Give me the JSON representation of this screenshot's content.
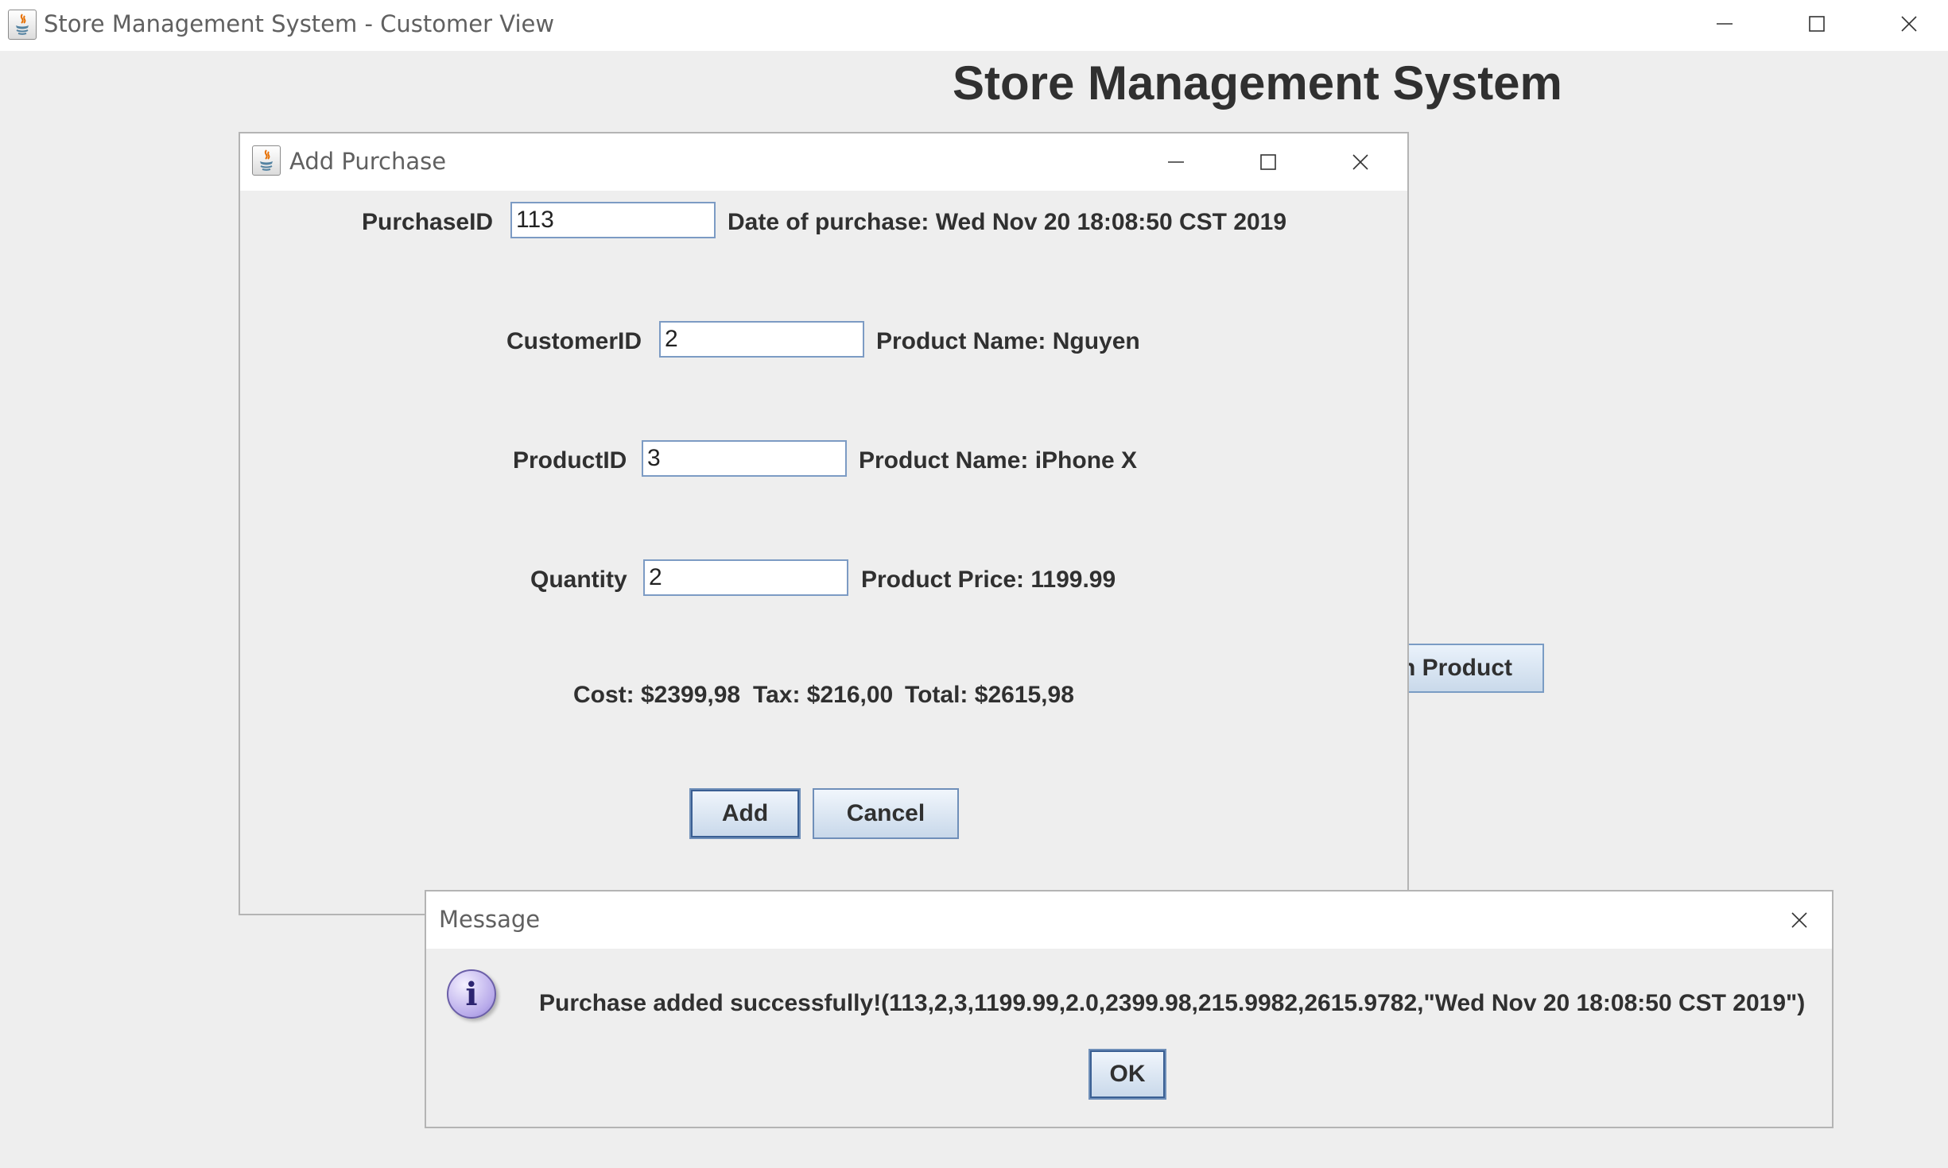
{
  "main_window": {
    "title": "Store Management System - Customer View",
    "heading": "Store Management System",
    "partial_button_label": "n Product"
  },
  "add_purchase": {
    "title": "Add Purchase",
    "purchase_id_label": "PurchaseID",
    "purchase_id_value": "113",
    "date_text": "Date of purchase: Wed Nov 20 18:08:50 CST 2019",
    "customer_id_label": "CustomerID",
    "customer_id_value": "2",
    "customer_name_text": "Product Name: Nguyen",
    "product_id_label": "ProductID",
    "product_id_value": "3",
    "product_name_text": "Product Name: iPhone X",
    "quantity_label": "Quantity",
    "quantity_value": "2",
    "product_price_text": "Product Price: 1199.99",
    "cost_text": "Cost: $2399,98",
    "tax_text": "Tax: $216,00",
    "total_text": "Total: $2615,98",
    "add_label": "Add",
    "cancel_label": "Cancel"
  },
  "message": {
    "title": "Message",
    "icon": "info-icon",
    "icon_glyph": "i",
    "text": "Purchase added successfully!(113,2,3,1199.99,2.0,2399.98,215.9982,2615.9782,\"Wed Nov 20 18:08:50 CST 2019\")",
    "ok_label": "OK"
  },
  "colors": {
    "background": "#eeeeee",
    "titlebar": "#ffffff",
    "button_border": "#6f8fb9",
    "field_border": "#7c9bc4"
  }
}
